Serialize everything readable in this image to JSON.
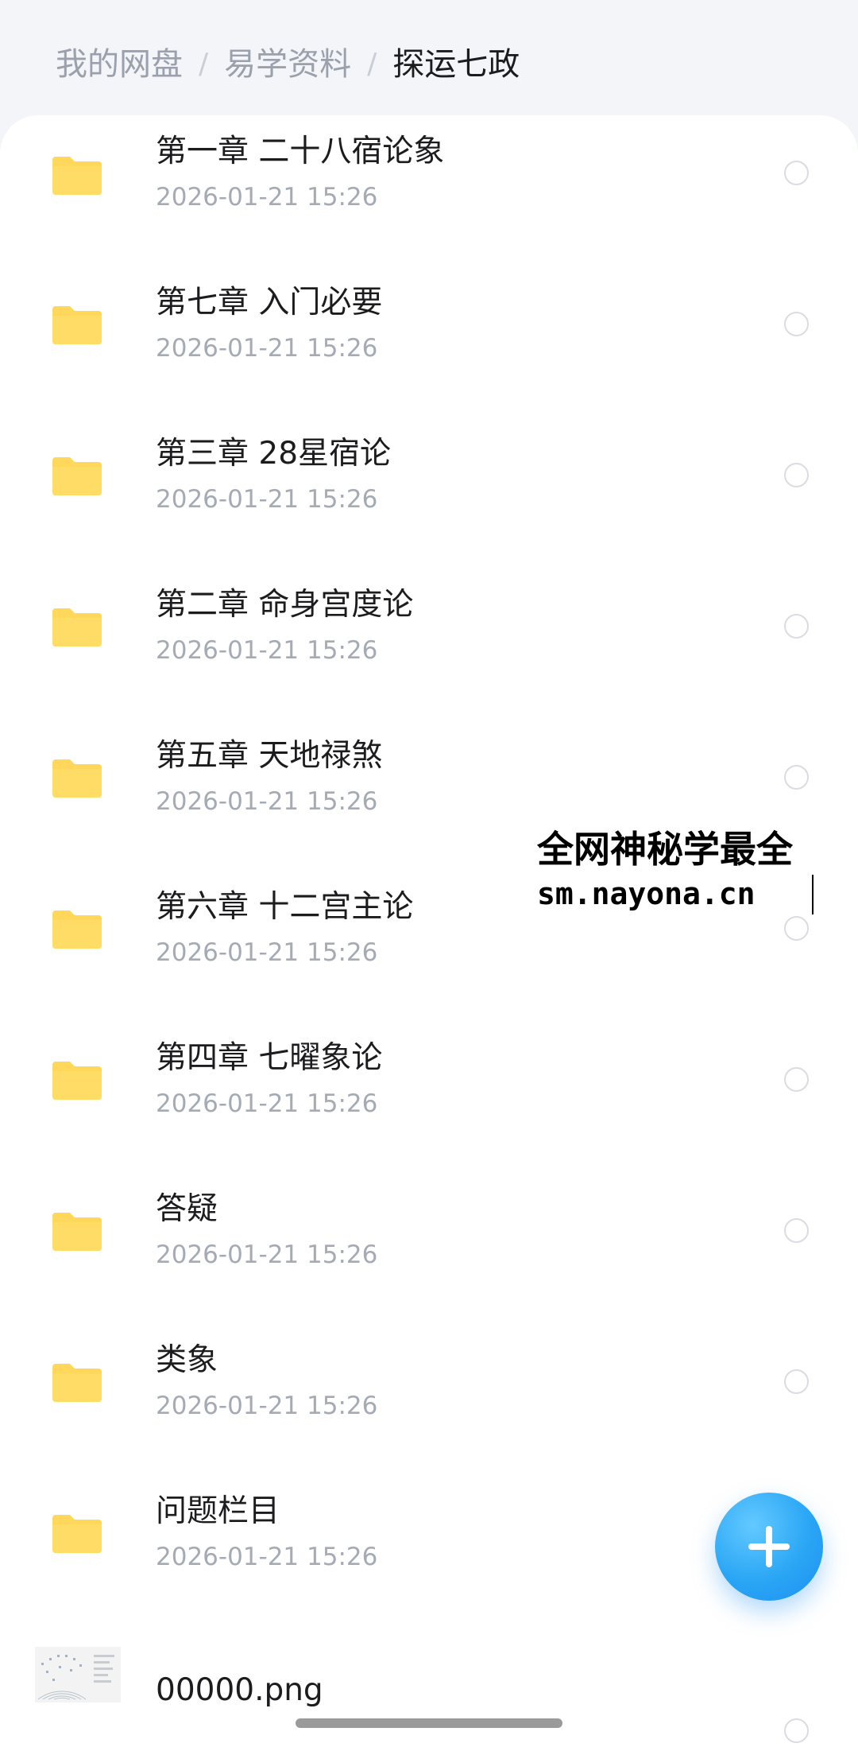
{
  "breadcrumb": {
    "items": [
      "我的网盘",
      "易学资料",
      "探运七政"
    ],
    "separator": "/"
  },
  "folders": [
    {
      "name": "第一章 二十八宿论象",
      "date": "2026-01-21  15:26"
    },
    {
      "name": "第七章 入门必要",
      "date": "2026-01-21  15:26"
    },
    {
      "name": "第三章 28星宿论",
      "date": "2026-01-21  15:26"
    },
    {
      "name": "第二章 命身宫度论",
      "date": "2026-01-21  15:26"
    },
    {
      "name": "第五章 天地禄煞",
      "date": "2026-01-21  15:26"
    },
    {
      "name": "第六章 十二宫主论",
      "date": "2026-01-21  15:26"
    },
    {
      "name": "第四章 七曜象论",
      "date": "2026-01-21  15:26"
    },
    {
      "name": "答疑",
      "date": "2026-01-21  15:26"
    },
    {
      "name": "类象",
      "date": "2026-01-21  15:26"
    },
    {
      "name": "问题栏目",
      "date": "2026-01-21  15:26"
    }
  ],
  "file": {
    "name": "00000.png"
  },
  "watermark": {
    "line1": "全网神秘学最全",
    "line2": "sm.nayona.cn"
  },
  "colors": {
    "folder": "#ffd75a",
    "fab": "#2aa6f5",
    "date_text": "#a5abb5",
    "breadcrumb_inactive": "#9aa1ad"
  }
}
